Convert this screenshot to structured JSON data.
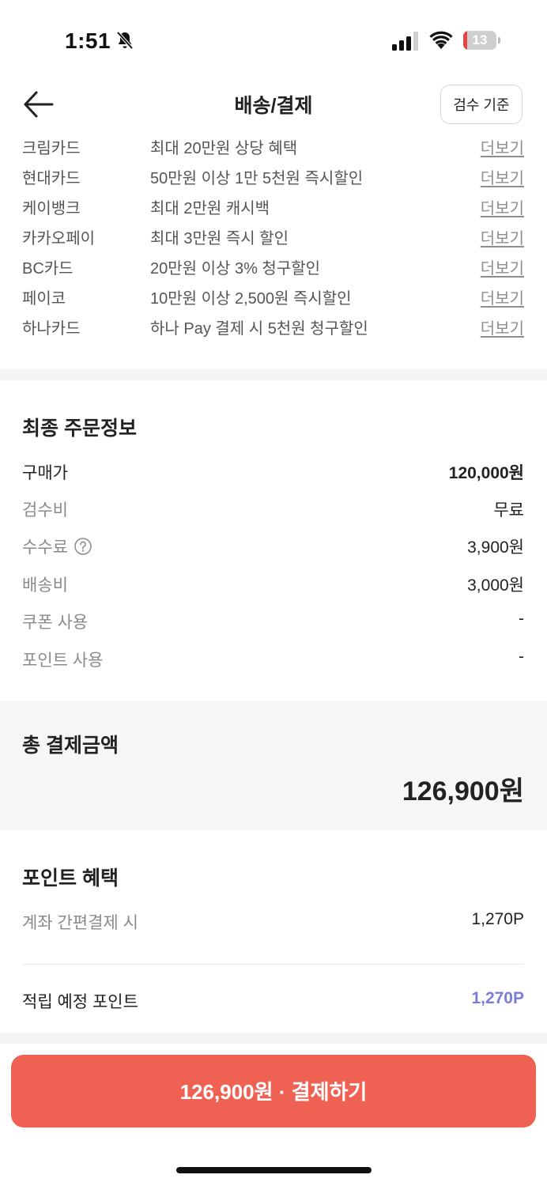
{
  "status_bar": {
    "time": "1:51",
    "battery": "13",
    "battery_level": 0.13
  },
  "header": {
    "title": "배송/결제",
    "criteria_button": "검수 기준"
  },
  "promos": [
    {
      "card": "크림카드",
      "desc": "최대 20만원 상당 혜택",
      "more": "더보기"
    },
    {
      "card": "현대카드",
      "desc": "50만원 이상 1만 5천원 즉시할인",
      "more": "더보기"
    },
    {
      "card": "케이뱅크",
      "desc": "최대 2만원 캐시백",
      "more": "더보기"
    },
    {
      "card": "카카오페이",
      "desc": "최대 3만원 즉시 할인",
      "more": "더보기"
    },
    {
      "card": "BC카드",
      "desc": "20만원 이상 3% 청구할인",
      "more": "더보기"
    },
    {
      "card": "페이코",
      "desc": "10만원 이상 2,500원 즉시할인",
      "more": "더보기"
    },
    {
      "card": "하나카드",
      "desc": "하나 Pay 결제 시 5천원 청구할인",
      "more": "더보기"
    }
  ],
  "order_info": {
    "title": "최종 주문정보",
    "purchase_price": {
      "label": "구매가",
      "value": "120,000원"
    },
    "inspection_fee": {
      "label": "검수비",
      "value": "무료"
    },
    "commission": {
      "label": "수수료",
      "value": "3,900원"
    },
    "shipping": {
      "label": "배송비",
      "value": "3,000원"
    },
    "coupon": {
      "label": "쿠폰 사용",
      "value": "-"
    },
    "points": {
      "label": "포인트 사용",
      "value": "-"
    }
  },
  "total": {
    "label": "총 결제금액",
    "value": "126,900원"
  },
  "point_benefit": {
    "title": "포인트 혜택",
    "account_pay": {
      "label": "계좌 간편결제 시",
      "value": "1,270P"
    },
    "expected": {
      "label": "적립 예정 포인트",
      "value": "1,270P"
    }
  },
  "pay_button": {
    "label": "126,900원 · 결제하기"
  },
  "colors": {
    "accent": "#7b7bd8",
    "pay_button": "#ef6253",
    "battery_low": "#e9433f"
  },
  "icons": [
    "bell-slash-icon",
    "signal-icon",
    "wifi-icon",
    "battery-icon",
    "back-arrow-icon",
    "help-circle-icon"
  ]
}
